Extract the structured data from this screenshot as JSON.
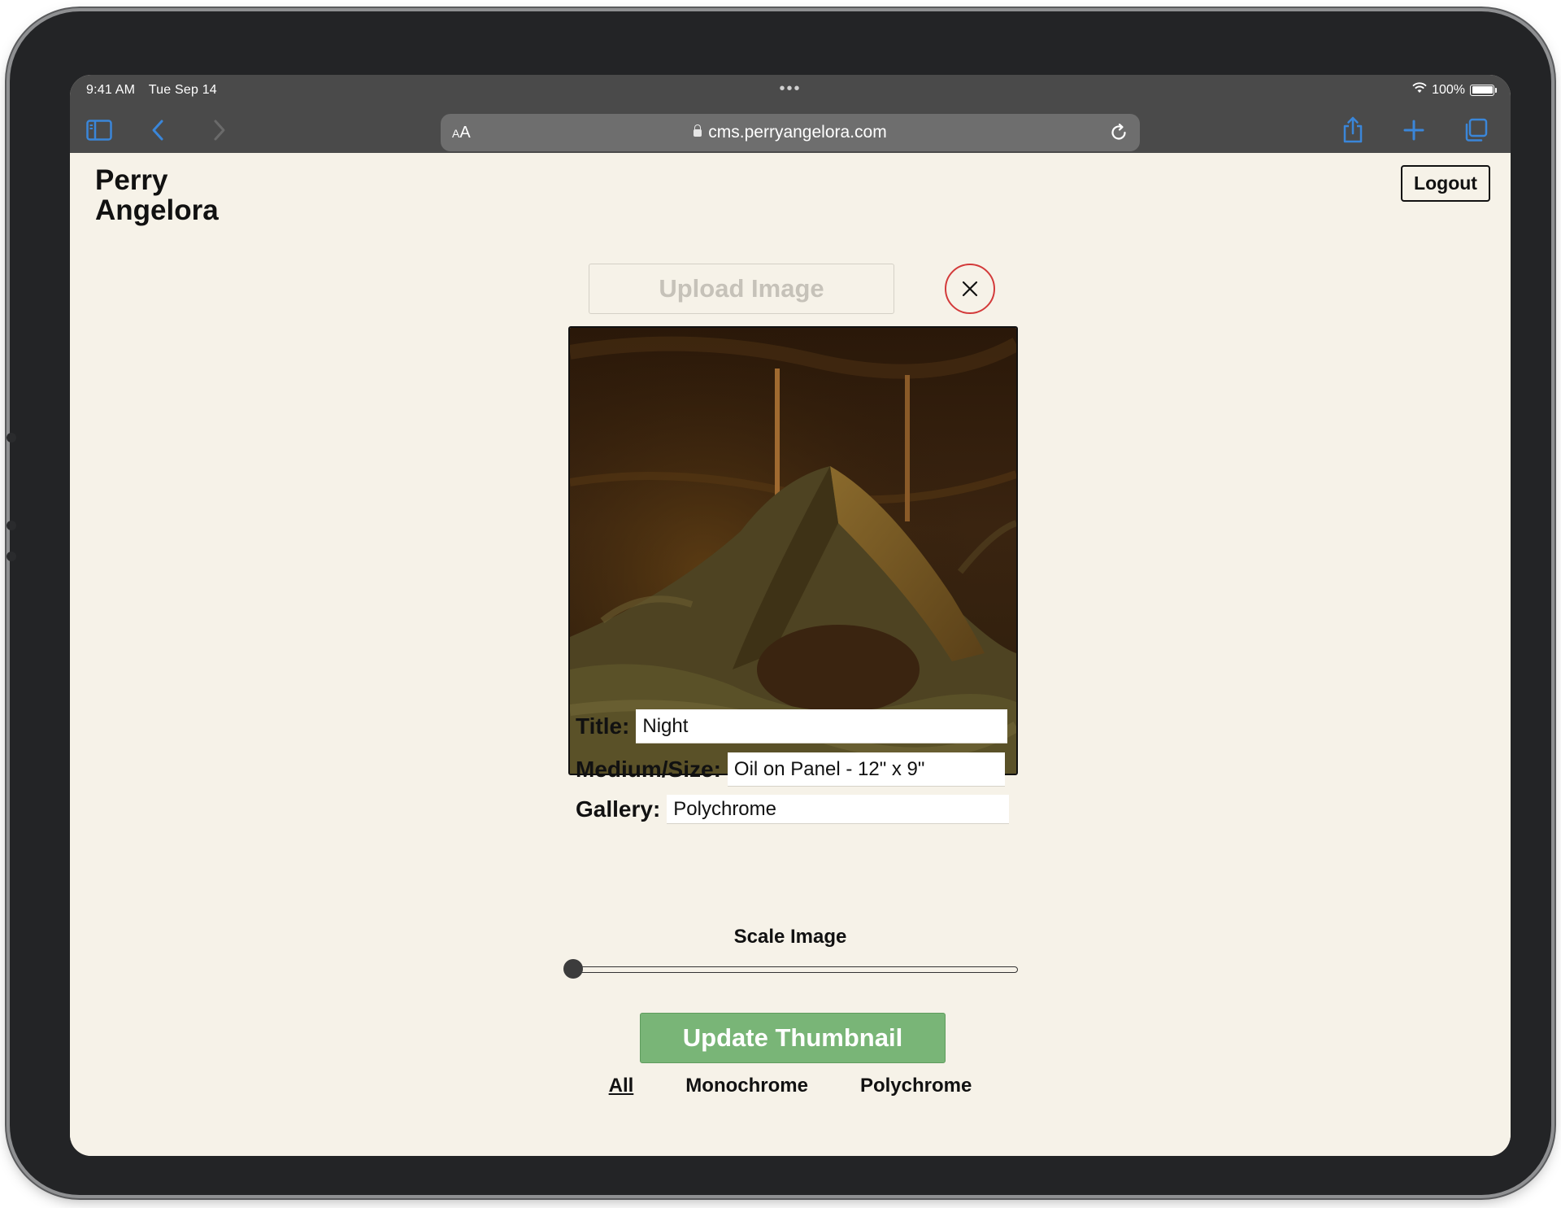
{
  "status_bar": {
    "time": "9:41 AM",
    "date": "Tue Sep 14",
    "battery": "100%"
  },
  "browser": {
    "url": "cms.perryangelora.com",
    "text_size_small": "A",
    "text_size_large": "A",
    "icons": {
      "sidebar": "sidebar-icon",
      "back": "back-icon",
      "forward": "forward-icon",
      "lock": "lock-icon",
      "reload": "reload-icon",
      "share": "share-icon",
      "new_tab": "plus-icon",
      "tabs": "tabs-icon"
    }
  },
  "site": {
    "brand_line1": "Perry",
    "brand_line2": "Angelora",
    "logout_label": "Logout"
  },
  "editor": {
    "upload_label": "Upload Image",
    "title_label": "Title:",
    "title_value": "Night",
    "medium_label": "Medium/Size:",
    "medium_value": "Oil on Panel - 12\" x 9\"",
    "gallery_label": "Gallery:",
    "gallery_value": "Polychrome",
    "scale_label": "Scale Image",
    "scale_value": 0,
    "update_label": "Update Thumbnail"
  },
  "filters": [
    {
      "label": "All",
      "active": true
    },
    {
      "label": "Monochrome",
      "active": false
    },
    {
      "label": "Polychrome",
      "active": false
    }
  ],
  "colors": {
    "page_bg": "#f6f2e8",
    "update_button": "#79b577",
    "remove_border": "#d33a3a",
    "browser_chrome": "#4a4a4a",
    "accent_blue": "#3a86d9"
  }
}
